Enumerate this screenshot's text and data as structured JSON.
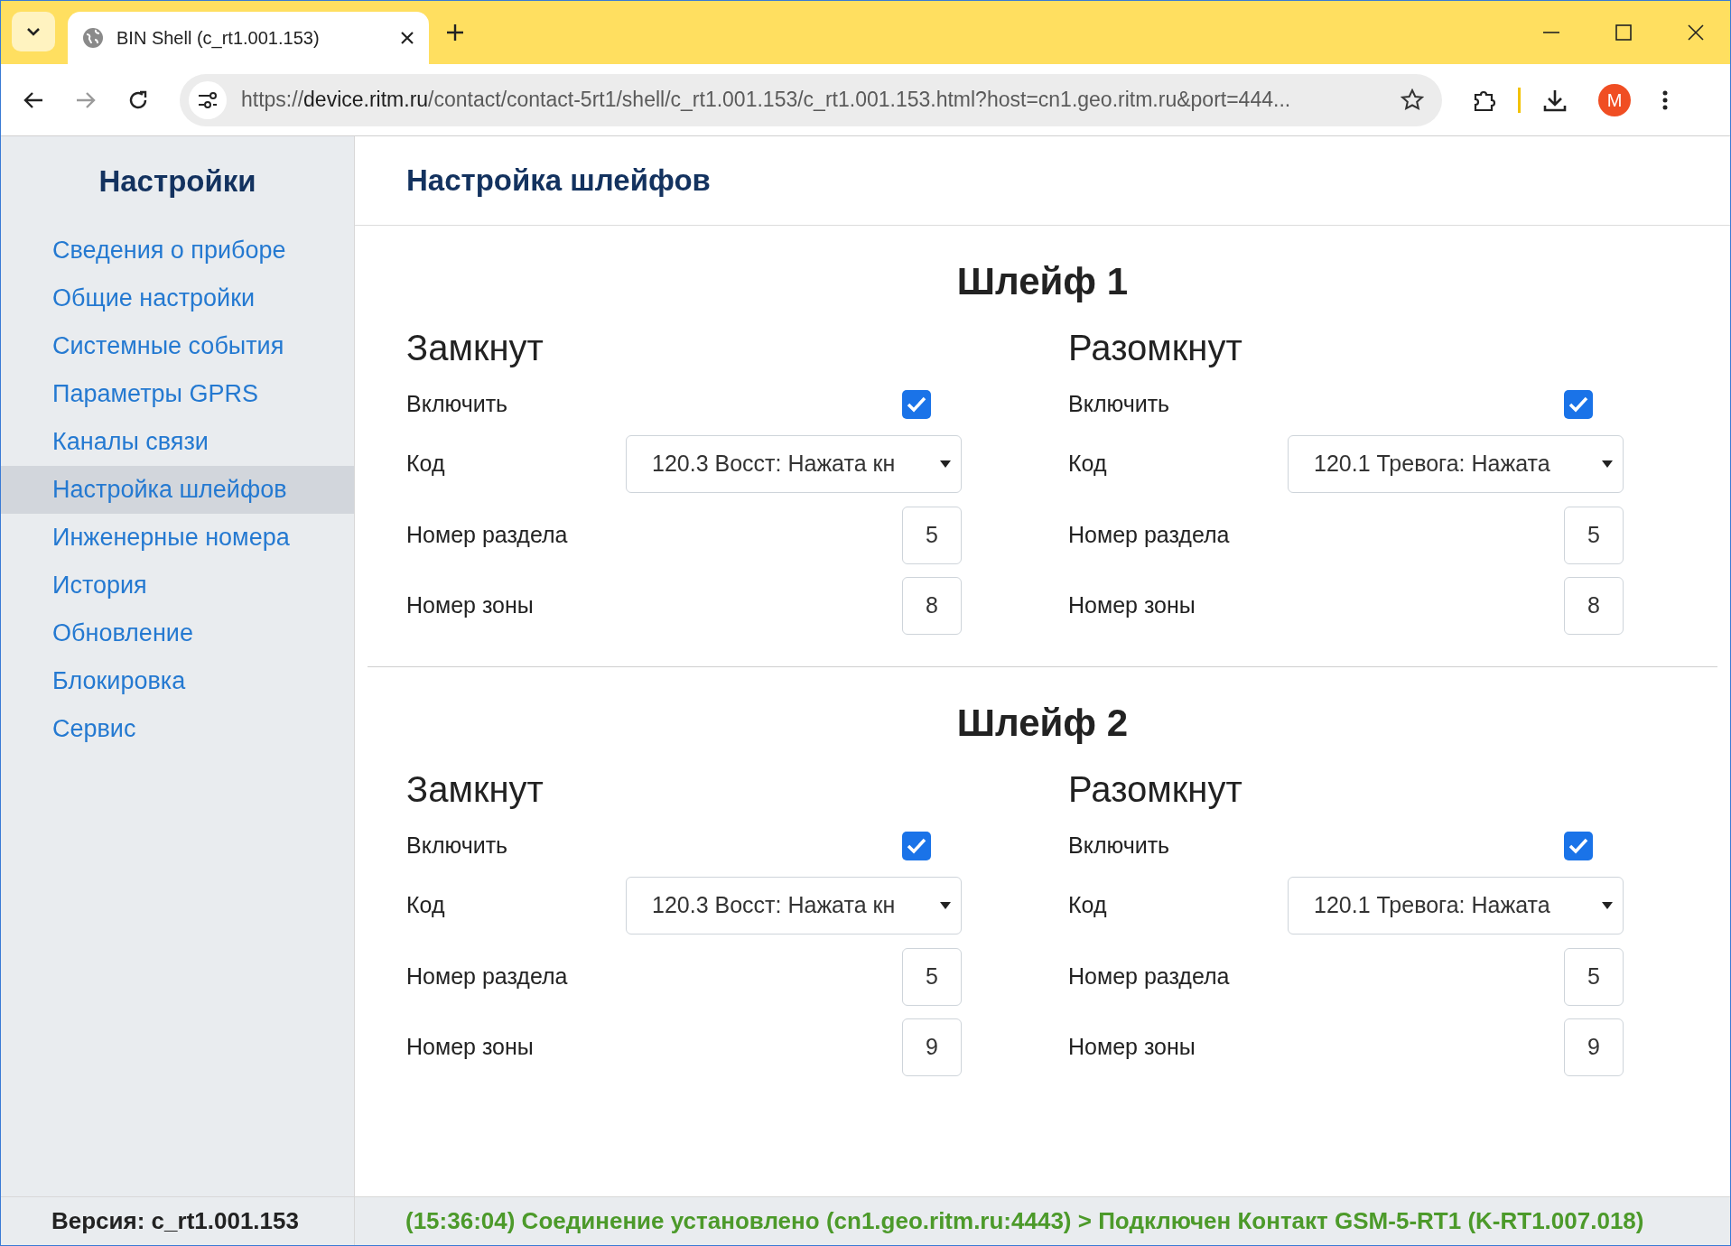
{
  "browser": {
    "tab_title": "BIN Shell (c_rt1.001.153)",
    "url_scheme": "https://",
    "url_host": "device.ritm.ru",
    "url_rest": "/contact/contact-5rt1/shell/c_rt1.001.153/c_rt1.001.153.html?host=cn1.geo.ritm.ru&port=444...",
    "avatar": "M"
  },
  "sidebar": {
    "title": "Настройки",
    "items": [
      {
        "label": "Сведения о приборе",
        "selected": false
      },
      {
        "label": "Общие настройки",
        "selected": false
      },
      {
        "label": "Системные события",
        "selected": false
      },
      {
        "label": "Параметры GPRS",
        "selected": false
      },
      {
        "label": "Каналы связи",
        "selected": false
      },
      {
        "label": "Настройка шлейфов",
        "selected": true
      },
      {
        "label": "Инженерные номера",
        "selected": false
      },
      {
        "label": "История",
        "selected": false
      },
      {
        "label": "Обновление",
        "selected": false
      },
      {
        "label": "Блокировка",
        "selected": false
      },
      {
        "label": "Сервис",
        "selected": false
      }
    ],
    "version": "Версия: c_rt1.001.153"
  },
  "main": {
    "title": "Настройка шлейфов",
    "loops": [
      {
        "title": "Шлейф 1",
        "states": [
          {
            "title": "Замкнут",
            "enable_label": "Включить",
            "enabled": true,
            "code_label": "Код",
            "code": "120.3 Восст: Нажата кн",
            "section_label": "Номер раздела",
            "section": "5",
            "zone_label": "Номер зоны",
            "zone": "8"
          },
          {
            "title": "Разомкнут",
            "enable_label": "Включить",
            "enabled": true,
            "code_label": "Код",
            "code": "120.1 Тревога: Нажата",
            "section_label": "Номер раздела",
            "section": "5",
            "zone_label": "Номер зоны",
            "zone": "8"
          }
        ]
      },
      {
        "title": "Шлейф 2",
        "states": [
          {
            "title": "Замкнут",
            "enable_label": "Включить",
            "enabled": true,
            "code_label": "Код",
            "code": "120.3 Восст: Нажата кн",
            "section_label": "Номер раздела",
            "section": "5",
            "zone_label": "Номер зоны",
            "zone": "9"
          },
          {
            "title": "Разомкнут",
            "enable_label": "Включить",
            "enabled": true,
            "code_label": "Код",
            "code": "120.1 Тревога: Нажата",
            "section_label": "Номер раздела",
            "section": "5",
            "zone_label": "Номер зоны",
            "zone": "9"
          }
        ]
      }
    ]
  },
  "status": "(15:36:04) Соединение установлено (cn1.geo.ritm.ru:4443) > Подключен Контакт GSM-5-RT1 (K-RT1.007.018)"
}
